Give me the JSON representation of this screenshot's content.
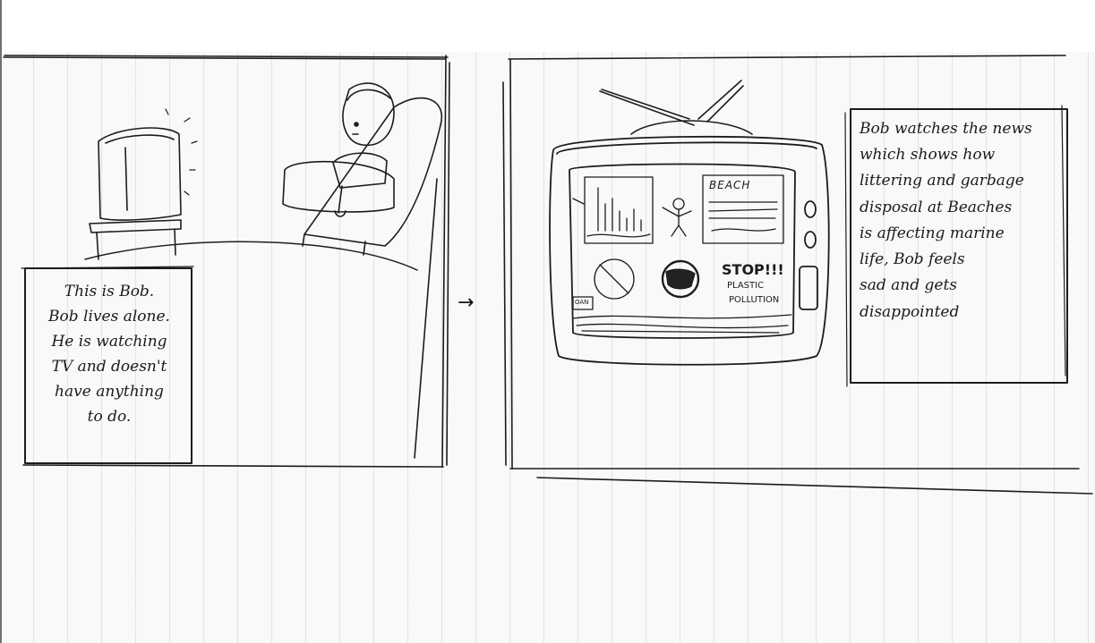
{
  "panel_1": {
    "caption": [
      "This is Bob.",
      "Bob lives alone.",
      "He is watching",
      "TV and doesn't",
      "have anything",
      "to do."
    ]
  },
  "arrow": "→",
  "panel_2": {
    "tv_screen": {
      "beach_sign": "BEACH",
      "stop_text": "STOP!!!",
      "plastic_text": "PLASTIC",
      "pollution_text": "POLLUTION",
      "box_label": "OAN"
    },
    "caption": [
      "Bob watches the news",
      "which shows how",
      "littering and garbage",
      "disposal at Beaches",
      "is affecting marine",
      "life, Bob feels",
      "sad and gets",
      "disappointed"
    ]
  }
}
